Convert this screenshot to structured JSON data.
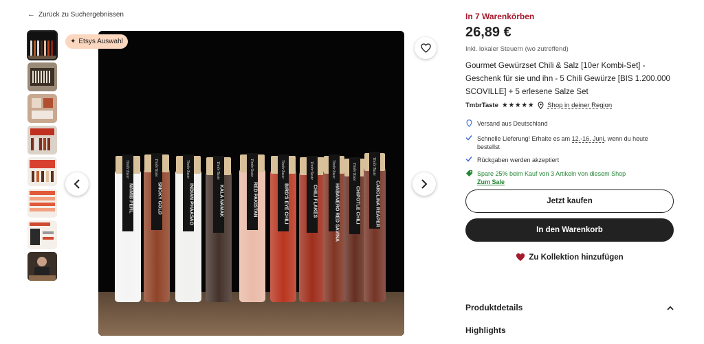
{
  "nav": {
    "back_label": "Zurück zu Suchergebnissen"
  },
  "gallery": {
    "badge_label": "Etsys Auswahl",
    "thumbnails": [
      {
        "name": "thumb-1"
      },
      {
        "name": "thumb-2"
      },
      {
        "name": "thumb-3"
      },
      {
        "name": "thumb-4"
      },
      {
        "name": "thumb-5"
      },
      {
        "name": "thumb-6"
      },
      {
        "name": "thumb-7"
      },
      {
        "name": "thumb-8"
      }
    ],
    "jar_labels": [
      "NAMIB PERL",
      "SMOKY GOLD",
      "INDIAN PHAASAO",
      "KALA NAMAK",
      "RED PAKISTAN",
      "BIRD'S EYE CHILI",
      "CHILI FLAKES",
      "HABANERO RED SAVINA",
      "CHIPOTLE CHILI",
      "CAROLINA REAPER"
    ],
    "brand_mark": "TimbrTaste"
  },
  "product": {
    "carts_label": "In 7 Warenkörben",
    "price": "26,89 €",
    "tax_note": "Inkl. lokaler Steuern (wo zutreffend)",
    "title": "Gourmet Gewürzset Chili & Salz [10er Kombi-Set] - Geschenk für sie und ihn - 5 Chili Gewürze [BIS 1.200.000 SCOVILLE] + 5 erlesene Salze Set",
    "shop_name": "TmbrTaste",
    "stars": "★★★★★",
    "region_label": "Shop in deiner Region"
  },
  "features": {
    "shipping_from": "Versand aus Deutschland",
    "fast_delivery_prefix": "Schnelle Lieferung! Erhalte es am ",
    "fast_delivery_dates": "12.-16. Juni",
    "fast_delivery_suffix": ", wenn du heute bestellst",
    "returns": "Rückgaben werden akzeptiert",
    "promo": "Spare 25% beim Kauf von 3 Artikeln von diesem Shop",
    "sale_link": "Zum Sale"
  },
  "actions": {
    "buy_now": "Jetzt kaufen",
    "add_to_cart": "In den Warenkorb",
    "add_to_collection": "Zu Kollektion hinzufügen"
  },
  "details": {
    "product_details_label": "Produktdetails",
    "highlights_label": "Highlights"
  },
  "colors": {
    "carts_red": "#a61a2e",
    "promo_green": "#258635",
    "badge_peach": "#fcd7c0",
    "dark": "#222222"
  }
}
